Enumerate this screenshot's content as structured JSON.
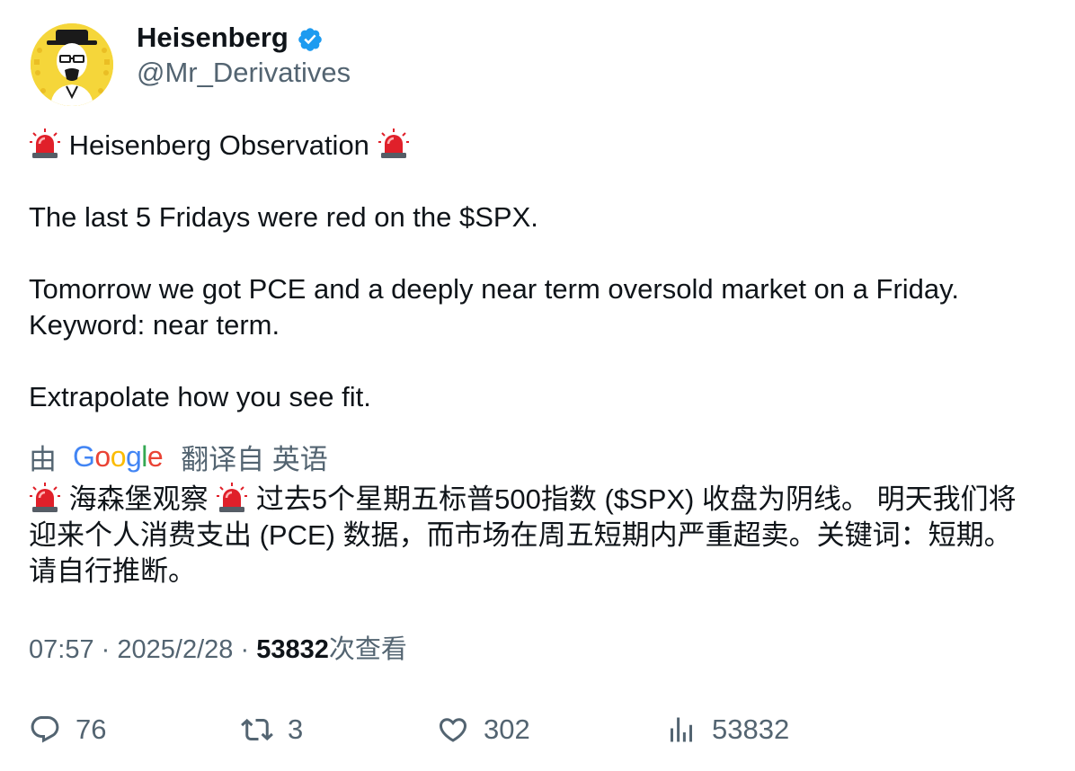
{
  "author": {
    "display_name": "Heisenberg",
    "handle": "@Mr_Derivatives",
    "verified": true,
    "avatar_icon": "heisenberg-avatar"
  },
  "tweet": {
    "line1_text": "Heisenberg Observation",
    "line2": "The last 5 Fridays were red on the $SPX.",
    "line3": "Tomorrow we got PCE and a deeply near term oversold market on a Friday.",
    "line4": "Keyword: near term.",
    "line5": "Extrapolate how you see fit.",
    "emoji_icon": "police-light-icon"
  },
  "translation": {
    "by_label": "由",
    "provider": "Google",
    "from_label": "翻译自 英语",
    "text_part1": "海森堡观察",
    "text_part2": "过去5个星期五标普500指数 ($SPX) 收盘为阴线。 明天我们将迎来个人消费支出 (PCE) 数据，而市场在周五短期内严重超卖。关键词：短期。 请自行推断。"
  },
  "meta": {
    "time": "07:57",
    "separator": "·",
    "date": "2025/2/28",
    "views_count": "53832",
    "views_label": "次查看"
  },
  "actions": {
    "reply_count": "76",
    "retweet_count": "3",
    "like_count": "302",
    "views_count": "53832"
  },
  "colors": {
    "text": "#0f1419",
    "secondary": "#536471",
    "verified_blue": "#1d9bf0",
    "avatar_bg": "#f5d63a",
    "siren_red": "#e0202a"
  }
}
